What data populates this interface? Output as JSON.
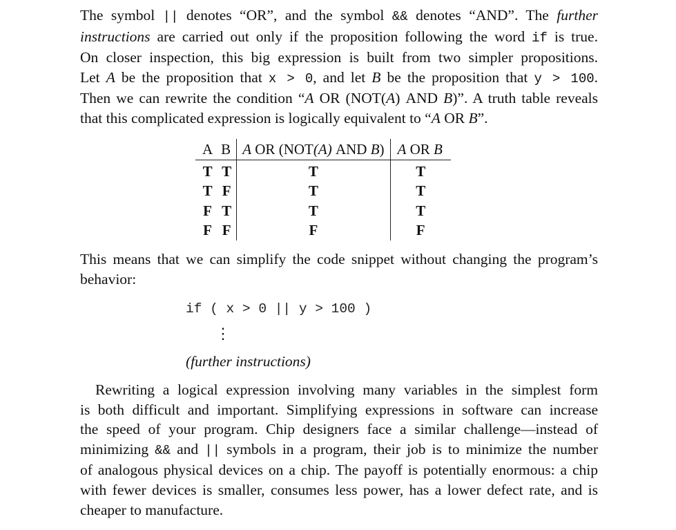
{
  "para1": {
    "lines": [
      [
        "The symbol ",
        "||",
        " denotes “",
        "OR",
        "”, and the symbol ",
        "&&",
        " denotes “",
        "AND",
        "”. The ",
        "further"
      ],
      [
        "instructions",
        " are carried out only if the proposition following the word ",
        "if",
        " is true."
      ],
      [
        "On closer inspection, this big expression is built from two simpler propositions."
      ],
      [
        "Let ",
        "A",
        " be the proposition that ",
        "x > 0",
        ", and let ",
        "B",
        " be the proposition that ",
        "y > 100",
        "."
      ],
      [
        "Then we can rewrite the condition “",
        "A",
        " ",
        "OR",
        " (",
        "NOT",
        "(",
        "A",
        ") ",
        "AND",
        " ",
        "B",
        ")”. A truth table reveals"
      ],
      [
        "that this complicated expression is logically equivalent to “",
        "A",
        " ",
        "OR",
        " ",
        "B",
        "”."
      ]
    ]
  },
  "truth_table": {
    "headers": {
      "a": "A",
      "b": "B",
      "expr_a": "A",
      "expr_or": "OR",
      "expr_open": " (",
      "expr_not": "NOT",
      "expr_pa": "(A)",
      "expr_and": "AND",
      "expr_b": "B",
      "expr_close": ")",
      "simp_a": "A",
      "simp_or": "OR",
      "simp_b": "B"
    },
    "rows": [
      {
        "a": "T",
        "b": "T",
        "expr": "T",
        "simp": "T"
      },
      {
        "a": "T",
        "b": "F",
        "expr": "T",
        "simp": "T"
      },
      {
        "a": "F",
        "b": "T",
        "expr": "T",
        "simp": "T"
      },
      {
        "a": "F",
        "b": "F",
        "expr": "F",
        "simp": "F"
      }
    ]
  },
  "para2": {
    "line1": "This means that we can simplify the code snippet without changing the program’s",
    "line2": "behavior:"
  },
  "code": {
    "snippet": "if ( x > 0 || y > 100 )",
    "vdots": "⋮",
    "further": "(further instructions)"
  },
  "para3": {
    "lines": [
      "Rewriting a logical expression involving many variables in the simplest form",
      "is both difficult and important. Simplifying expressions in software can increase",
      "the speed of your program. Chip designers face a similar challenge—instead of",
      [
        "minimizing ",
        "&&",
        " and ",
        "||",
        " symbols in a program, their job is to minimize the number"
      ],
      "of analogous physical devices on a chip. The payoff is potentially enormous: a chip",
      "with fewer devices is smaller, consumes less power, has a lower defect rate, and is",
      "cheaper to manufacture."
    ]
  }
}
